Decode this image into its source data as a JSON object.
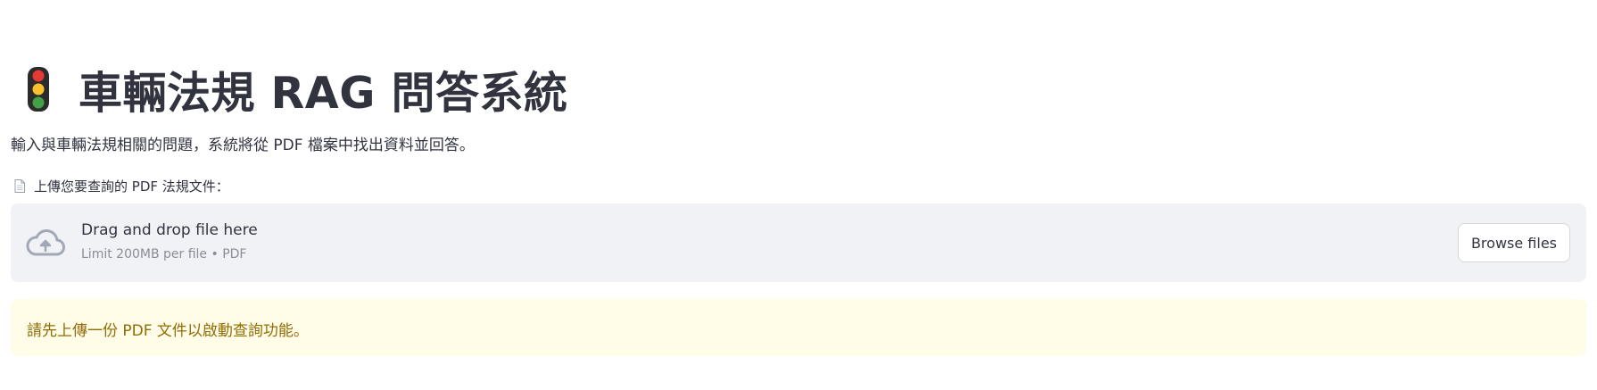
{
  "header": {
    "icon": "traffic-light-icon",
    "title": "車輛法規 RAG 問答系統"
  },
  "description": "輸入與車輛法規相關的問題，系統將從 PDF 檔案中找出資料並回答。",
  "uploader": {
    "label_icon": "document-icon",
    "label": "上傳您要查詢的 PDF 法規文件：",
    "dropzone_icon": "cloud-upload-icon",
    "dropzone_title": "Drag and drop file here",
    "dropzone_limit": "Limit 200MB per file • PDF",
    "browse_button": "Browse files"
  },
  "warning": {
    "text": "請先上傳一份 PDF 文件以啟動查詢功能。"
  },
  "colors": {
    "text": "#31333f",
    "dropzone_bg": "#f0f2f6",
    "warning_bg": "#fffce7",
    "warning_text": "#926c05",
    "icon_muted": "#a3a8b8"
  }
}
